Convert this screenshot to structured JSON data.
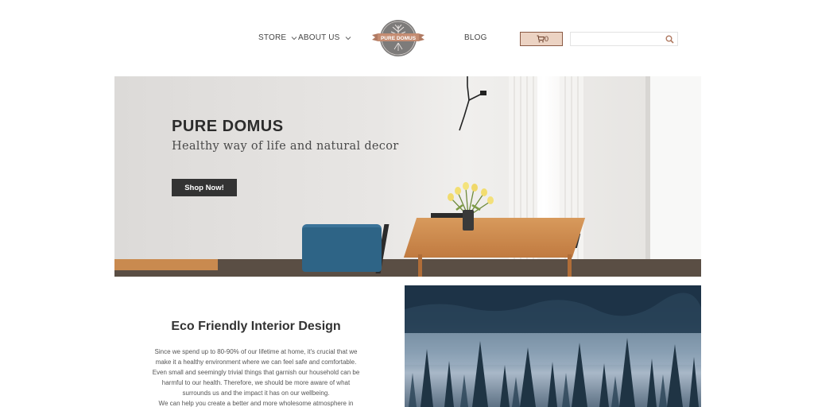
{
  "header": {
    "nav": {
      "store": "STORE",
      "about": "ABOUT US",
      "blog": "BLOG"
    },
    "logo_text": "PURE DOMUS",
    "cart_count": "0",
    "search_placeholder": ""
  },
  "hero": {
    "title": "PURE DOMUS",
    "subtitle": "Healthy way of life and natural decor",
    "cta_label": "Shop Now!"
  },
  "eco": {
    "title": "Eco Friendly Interior Design",
    "paragraph_lines": [
      "Since we spend up to 80-90% of our lifetime at home, it's crucial that we",
      "make it a healthy environment where we can feel safe and comfortable.",
      "Even small and seemingly trivial things that garnish our household can be",
      "harmful to our health. Therefore, we should be more aware of what",
      "surrounds us and the impact it has on our wellbeing.",
      "We can help you create a better and more wholesome atmosphere in"
    ]
  },
  "colors": {
    "accent": "#8a5a44",
    "cart_bg": "#ecd3c3",
    "button_dark": "#333333"
  },
  "icons": {
    "store_chevron": "chevron-down-icon",
    "about_chevron": "chevron-down-icon",
    "cart": "cart-icon",
    "search": "search-icon"
  }
}
